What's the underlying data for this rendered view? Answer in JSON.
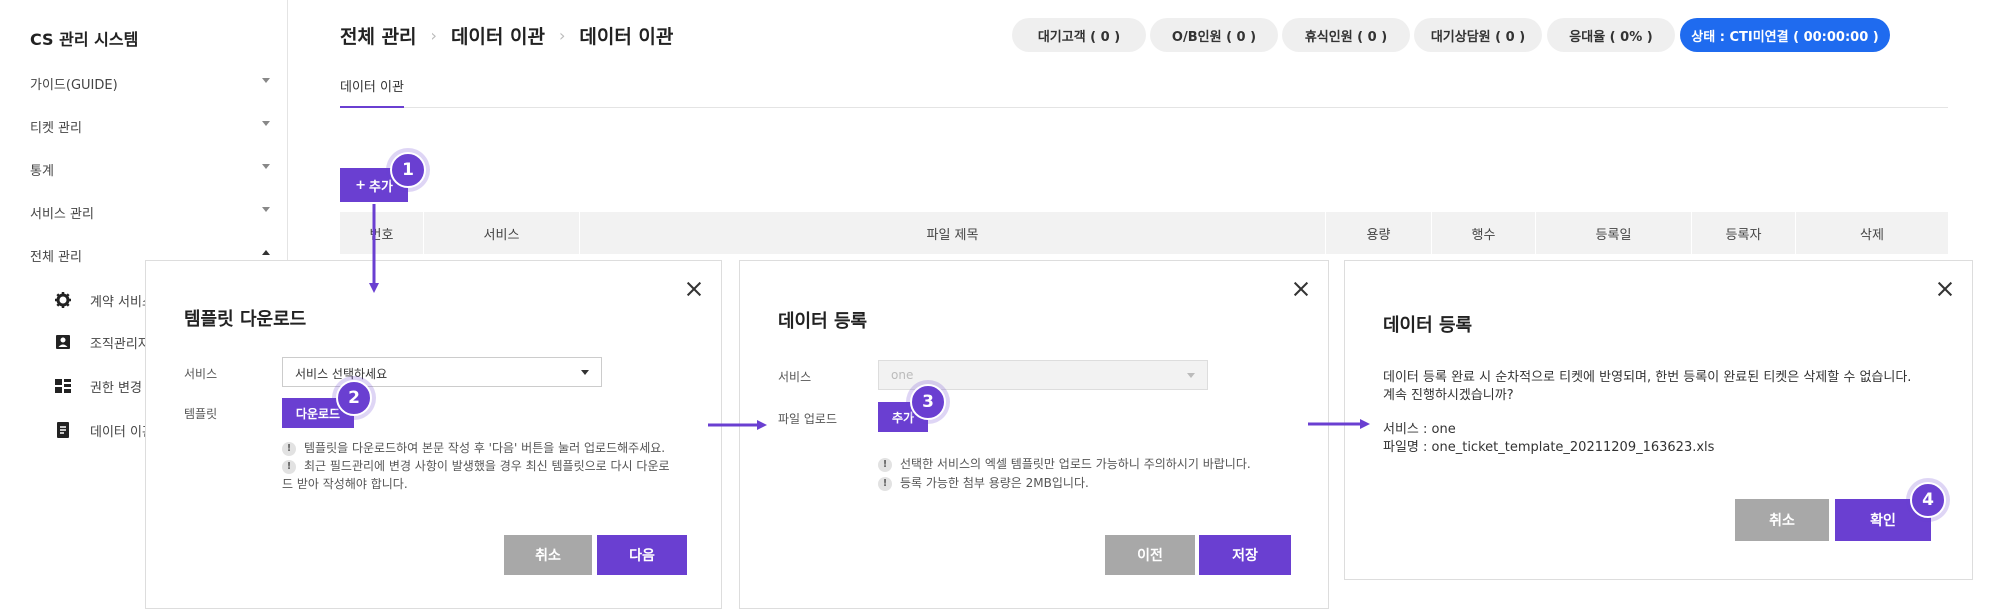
{
  "sidebar": {
    "brand": "CS 관리 시스템",
    "items": [
      {
        "label": "가이드(GUIDE)"
      },
      {
        "label": "티켓 관리"
      },
      {
        "label": "통계"
      },
      {
        "label": "서비스 관리"
      },
      {
        "label": "전체 관리"
      }
    ],
    "subitems": [
      {
        "label": "계약 서비스",
        "icon": "gear-icon"
      },
      {
        "label": "조직관리자",
        "icon": "person-card-icon"
      },
      {
        "label": "권한 변경",
        "icon": "permission-icon"
      },
      {
        "label": "데이터 이관",
        "icon": "document-icon"
      }
    ]
  },
  "breadcrumb": [
    "전체 관리",
    "데이터 이관",
    "데이터 이관"
  ],
  "status_pills": [
    {
      "label": "대기고객 ( 0 )"
    },
    {
      "label": "O/B인원 ( 0 )"
    },
    {
      "label": "휴식인원 ( 0 )"
    },
    {
      "label": "대기상담원 ( 0 )"
    },
    {
      "label": "응대율 ( 0% )"
    },
    {
      "label": "상태 : CTI미연결 ( 00:00:00 )"
    }
  ],
  "tab": {
    "label": "데이터 이관"
  },
  "toolbar": {
    "add_label": "추가"
  },
  "table": {
    "headers": [
      "번호",
      "서비스",
      "파일 제목",
      "용량",
      "행수",
      "등록일",
      "등록자",
      "삭제"
    ]
  },
  "modal1": {
    "title": "템플릿 다운로드",
    "service_label": "서비스",
    "service_placeholder": "서비스 선택하세요",
    "template_label": "템플릿",
    "download_label": "다운로드",
    "notes": [
      "템플릿을 다운로드하여 본문 작성 후 '다음' 버튼을 눌러 업로드해주세요.",
      "최근 필드관리에 변경 사항이 발생했을 경우 최신 템플릿으로 다시 다운로",
      "드 받아 작성해야 합니다."
    ],
    "cancel_label": "취소",
    "next_label": "다음"
  },
  "modal2": {
    "title": "데이터 등록",
    "service_label": "서비스",
    "service_value": "one",
    "upload_label": "파일 업로드",
    "add_label": "추가",
    "notes": [
      "선택한 서비스의 엑셀 템플릿만 업로드 가능하니 주의하시기 바랍니다.",
      "등록 가능한 첨부 용량은 2MB입니다."
    ],
    "prev_label": "이전",
    "save_label": "저장"
  },
  "modal3": {
    "title": "데이터 등록",
    "message_line1": "데이터 등록 완료 시 순차적으로 티켓에 반영되며, 한번 등록이 완료된 티켓은 삭제할 수 없습니다.",
    "message_line2": "계속 진행하시겠습니까?",
    "service_line": "서비스 : one",
    "filename_line": "파일명 : one_ticket_template_20211209_163623.xls",
    "cancel_label": "취소",
    "confirm_label": "확인"
  },
  "steps": [
    "1",
    "2",
    "3",
    "4"
  ],
  "colors": {
    "accent": "#6a3fd1",
    "status_blue": "#1f6bef",
    "pill_bg": "#efefef",
    "secondary_button": "#a8a8a8"
  }
}
